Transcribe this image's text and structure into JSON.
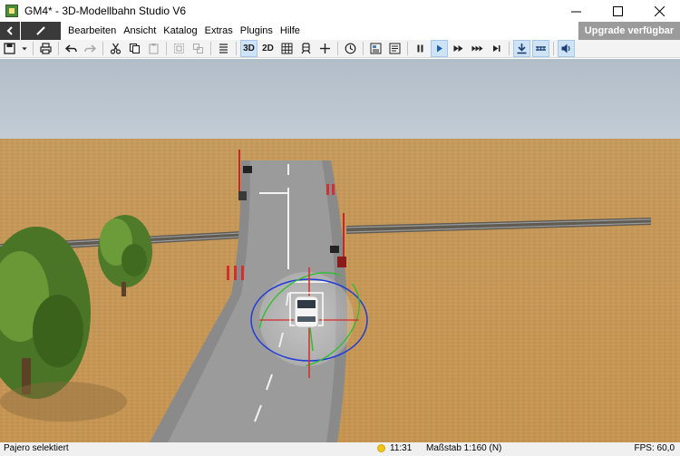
{
  "window": {
    "title": "GM4* - 3D-Modellbahn Studio V6",
    "minimize_icon": "minimize-icon",
    "maximize_icon": "maximize-icon",
    "close_icon": "close-icon"
  },
  "menu": {
    "items": [
      "Bearbeiten",
      "Ansicht",
      "Katalog",
      "Extras",
      "Plugins",
      "Hilfe"
    ],
    "upgrade_label": "Upgrade verfügbar"
  },
  "toolbar": {
    "view_3d_label": "3D",
    "view_2d_label": "2D"
  },
  "status": {
    "selection_text": "Pajero selektiert",
    "clock_time": "11:31",
    "scale_text": "Maßstab 1:160 (N)",
    "fps_text": "FPS: 60,0"
  },
  "colors": {
    "sky": "#b9c4cf",
    "ground": "#c79a5a",
    "road": "#8c8c8c",
    "track": "#6a6a6a",
    "accent_active": "#cfe3f7",
    "upgrade_bg": "#9b9b9b"
  }
}
